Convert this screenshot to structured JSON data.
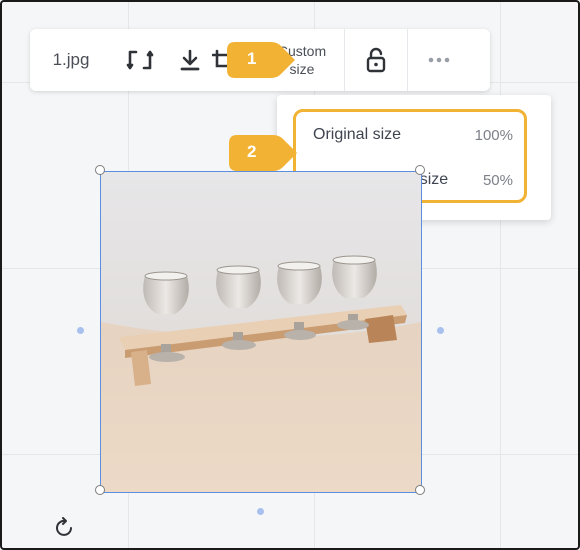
{
  "toolbar": {
    "file_name": "1.jpg",
    "custom_size_line1": "Custom",
    "custom_size_line2": "size"
  },
  "size_menu": {
    "items": [
      {
        "label": "Original size",
        "percent": "100%"
      },
      {
        "label": "Half of original size",
        "percent": "50%"
      }
    ]
  },
  "callouts": [
    "1",
    "2"
  ],
  "icons": {
    "flip": "flip-icon",
    "download": "download-icon",
    "crop": "crop-icon",
    "lock": "lock-open-icon",
    "more": "more-icon",
    "rotate": "rotate-icon"
  },
  "colors": {
    "accent_callout": "#F2B233",
    "selection": "#5B8DE0",
    "canvas_bg": "#F5F6F8"
  }
}
